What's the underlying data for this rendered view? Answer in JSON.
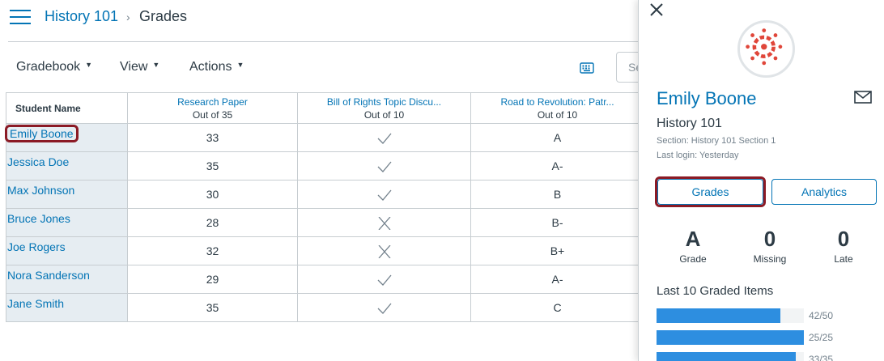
{
  "header": {
    "course": "History 101",
    "separator": "›",
    "page": "Grades"
  },
  "toolbar": {
    "gradebook": "Gradebook",
    "view": "View",
    "actions": "Actions",
    "caret": "▼",
    "search_placeholder": "Se"
  },
  "grid": {
    "name_header": "Student Name",
    "columns": [
      {
        "title": "Research Paper",
        "subtitle": "Out of 35"
      },
      {
        "title": "Bill of Rights Topic Discu...",
        "subtitle": "Out of 10"
      },
      {
        "title": "Road to Revolution: Patr...",
        "subtitle": "Out of 10"
      }
    ],
    "rows": [
      {
        "name": "Emily Boone",
        "paper": "33",
        "discussion": "check",
        "revolution": "A"
      },
      {
        "name": "Jessica Doe",
        "paper": "35",
        "discussion": "check",
        "revolution": "A-"
      },
      {
        "name": "Max Johnson",
        "paper": "30",
        "discussion": "check",
        "revolution": "B"
      },
      {
        "name": "Bruce Jones",
        "paper": "28",
        "discussion": "x",
        "revolution": "B-"
      },
      {
        "name": "Joe Rogers",
        "paper": "32",
        "discussion": "x",
        "revolution": "B+"
      },
      {
        "name": "Nora Sanderson",
        "paper": "29",
        "discussion": "check",
        "revolution": "A-"
      },
      {
        "name": "Jane Smith",
        "paper": "35",
        "discussion": "check",
        "revolution": "C"
      }
    ]
  },
  "tray": {
    "student_name": "Emily Boone",
    "course": "History 101",
    "section": "Section: History 101 Section 1",
    "last_login": "Last login: Yesterday",
    "grades_button": "Grades",
    "analytics_button": "Analytics",
    "stats": [
      {
        "value": "A",
        "label": "Grade"
      },
      {
        "value": "0",
        "label": "Missing"
      },
      {
        "value": "0",
        "label": "Late"
      }
    ],
    "items_title": "Last 10 Graded Items",
    "graded_items": [
      {
        "label": "42/50",
        "fraction": 0.84
      },
      {
        "label": "25/25",
        "fraction": 1.0
      },
      {
        "label": "33/35",
        "fraction": 0.943
      }
    ]
  },
  "colors": {
    "link": "#0374b5",
    "highlight": "#8b1a25",
    "bar": "#2d8ee0",
    "avatar_logo": "#e0463a"
  }
}
